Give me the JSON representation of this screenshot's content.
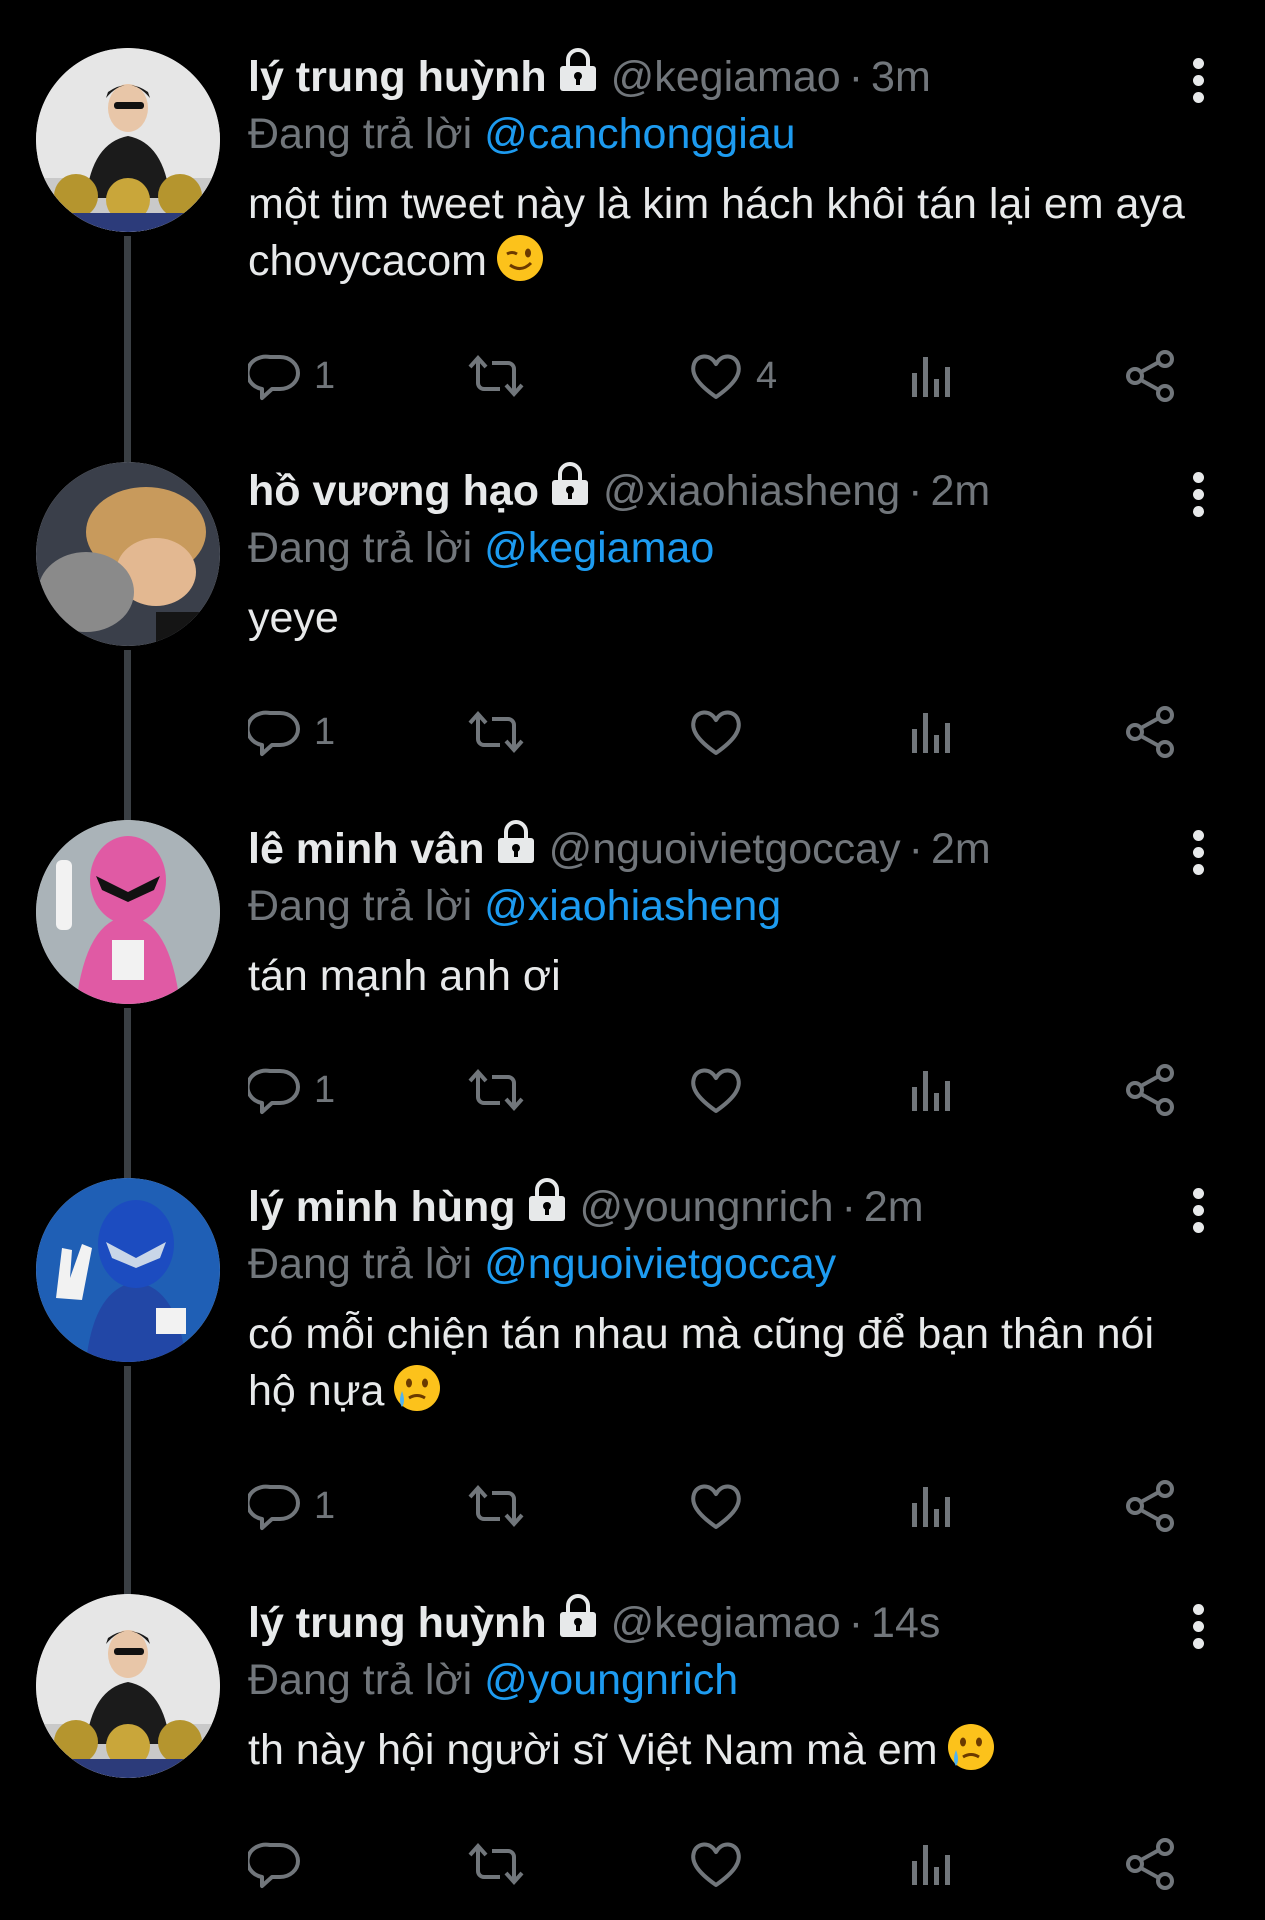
{
  "reply_prefix": "Đang trả lời",
  "tweets": [
    {
      "name": "lý trung huỳnh",
      "handle": "@kegiamao",
      "time": "3m",
      "reply_to": "@canchonggiau",
      "text": "một tim tweet này là kim hách khôi tán lại em aya chovycacom",
      "emoji": "wink-emoji",
      "reply_count": "1",
      "like_count": "4"
    },
    {
      "name": "hồ vương hạo",
      "handle": "@xiaohiasheng",
      "time": "2m",
      "reply_to": "@kegiamao",
      "text": "yeye",
      "reply_count": "1",
      "like_count": ""
    },
    {
      "name": "lê minh vân",
      "handle": "@nguoivietgoccay",
      "time": "2m",
      "reply_to": "@xiaohiasheng",
      "text": "tán mạnh anh ơi",
      "reply_count": "1",
      "like_count": ""
    },
    {
      "name": "lý minh hùng",
      "handle": "@youngnrich",
      "time": "2m",
      "reply_to": "@nguoivietgoccay",
      "text": "có mỗi chiện tán nhau mà cũng để bạn thân nói hộ nựa",
      "emoji": "crying-smile-emoji",
      "reply_count": "1",
      "like_count": ""
    },
    {
      "name": "lý trung huỳnh",
      "handle": "@kegiamao",
      "time": "14s",
      "reply_to": "@youngnrich",
      "text": "th này hội người sĩ Việt Nam mà em",
      "emoji": "crying-smile-emoji",
      "reply_count": "",
      "like_count": ""
    }
  ],
  "colors": {
    "background": "#000000",
    "text": "#e7e9ea",
    "secondary": "#71767b",
    "accent": "#1d9bf0",
    "thread_line": "#3a3f44"
  }
}
